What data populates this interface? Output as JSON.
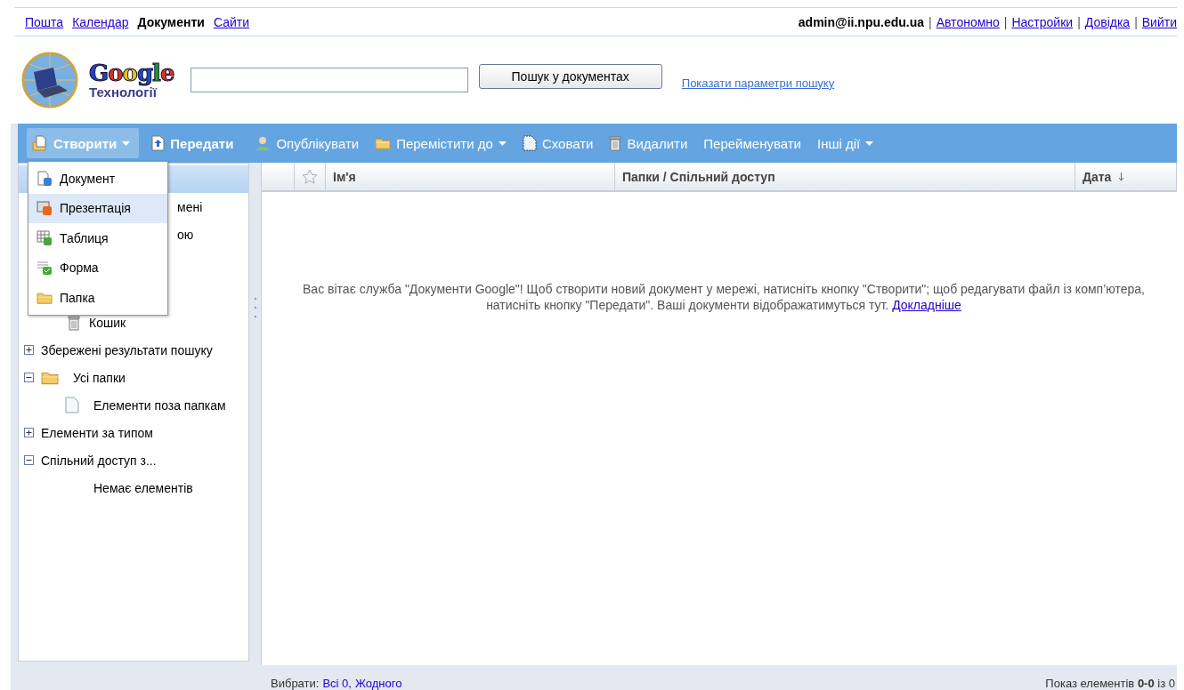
{
  "top_nav": {
    "links": [
      {
        "label": "Пошта",
        "selected": false
      },
      {
        "label": "Календар",
        "selected": false
      },
      {
        "label": "Документи",
        "selected": true
      },
      {
        "label": "Сайти",
        "selected": false
      }
    ]
  },
  "account": {
    "email": "admin@ii.npu.edu.ua",
    "separator": "|",
    "links": [
      "Автономно",
      "Настройки",
      "Довідка",
      "Вийти"
    ]
  },
  "logo": {
    "wordmark": "Google",
    "subtitle": "Технології"
  },
  "search": {
    "button": "Пошук у документах",
    "options_link": "Показати параметри пошуку"
  },
  "toolbar": {
    "items": [
      {
        "label": "Створити",
        "kind": "primary",
        "dropdown": true,
        "expanded": true
      },
      {
        "label": "Передати",
        "kind": "primary",
        "dropdown": false,
        "expanded": false
      },
      {
        "label": "Опублікувати",
        "kind": "action",
        "dropdown": false,
        "expanded": false
      },
      {
        "label": "Перемістити до",
        "kind": "action",
        "dropdown": true,
        "expanded": false
      },
      {
        "label": "Сховати",
        "kind": "action",
        "dropdown": false,
        "expanded": false
      },
      {
        "label": "Видалити",
        "kind": "action",
        "dropdown": false,
        "expanded": false
      },
      {
        "label": "Перейменувати",
        "kind": "action",
        "dropdown": false,
        "expanded": false
      },
      {
        "label": "Інші дії",
        "kind": "action",
        "dropdown": true,
        "expanded": false
      }
    ]
  },
  "create_menu": {
    "items": [
      {
        "label": "Документ",
        "selected": false
      },
      {
        "label": "Презентація",
        "selected": true
      },
      {
        "label": "Таблиця",
        "selected": false
      },
      {
        "label": "Форма",
        "selected": false
      },
      {
        "label": "Папка",
        "selected": false
      }
    ]
  },
  "sidebar": {
    "partial_items": [
      {
        "selected": true
      },
      {
        "label": "мені",
        "selected": false
      },
      {
        "label": "ою",
        "selected": false
      }
    ],
    "trash_label": "Кошик",
    "tree": [
      {
        "label": "Збережені результати пошуку",
        "kind": "group",
        "expanded": false
      },
      {
        "label": "Усі папки",
        "kind": "folder",
        "expanded": true,
        "children": [
          {
            "label": "Елементи поза папкам",
            "kind": "page"
          }
        ]
      },
      {
        "label": "Елементи за типом",
        "kind": "group",
        "expanded": false
      },
      {
        "label": "Спільний доступ з...",
        "kind": "group",
        "expanded": true,
        "children": [
          {
            "label": "Немає елементів",
            "kind": "empty"
          }
        ]
      }
    ]
  },
  "table": {
    "columns": [
      {
        "label": "Ім'я"
      },
      {
        "label": "Папки / Спільний доступ"
      },
      {
        "label": "Дата",
        "sorted": true
      }
    ],
    "empty_message": "Вас вітає служба \"Документи Google\"! Щоб створити новий документ у мережі, натисніть кнопку \"Створити\"; щоб редагувати файл із комп’ютера, натисніть кнопку \"Передати\". Ваші документи відображатимуться тут.",
    "empty_link": "Докладніше"
  },
  "footer": {
    "select_label": "Вибрати:",
    "select_links": [
      "Всі 0,",
      "Жодного"
    ],
    "count": "Показ елементів **0-0** із 0"
  }
}
